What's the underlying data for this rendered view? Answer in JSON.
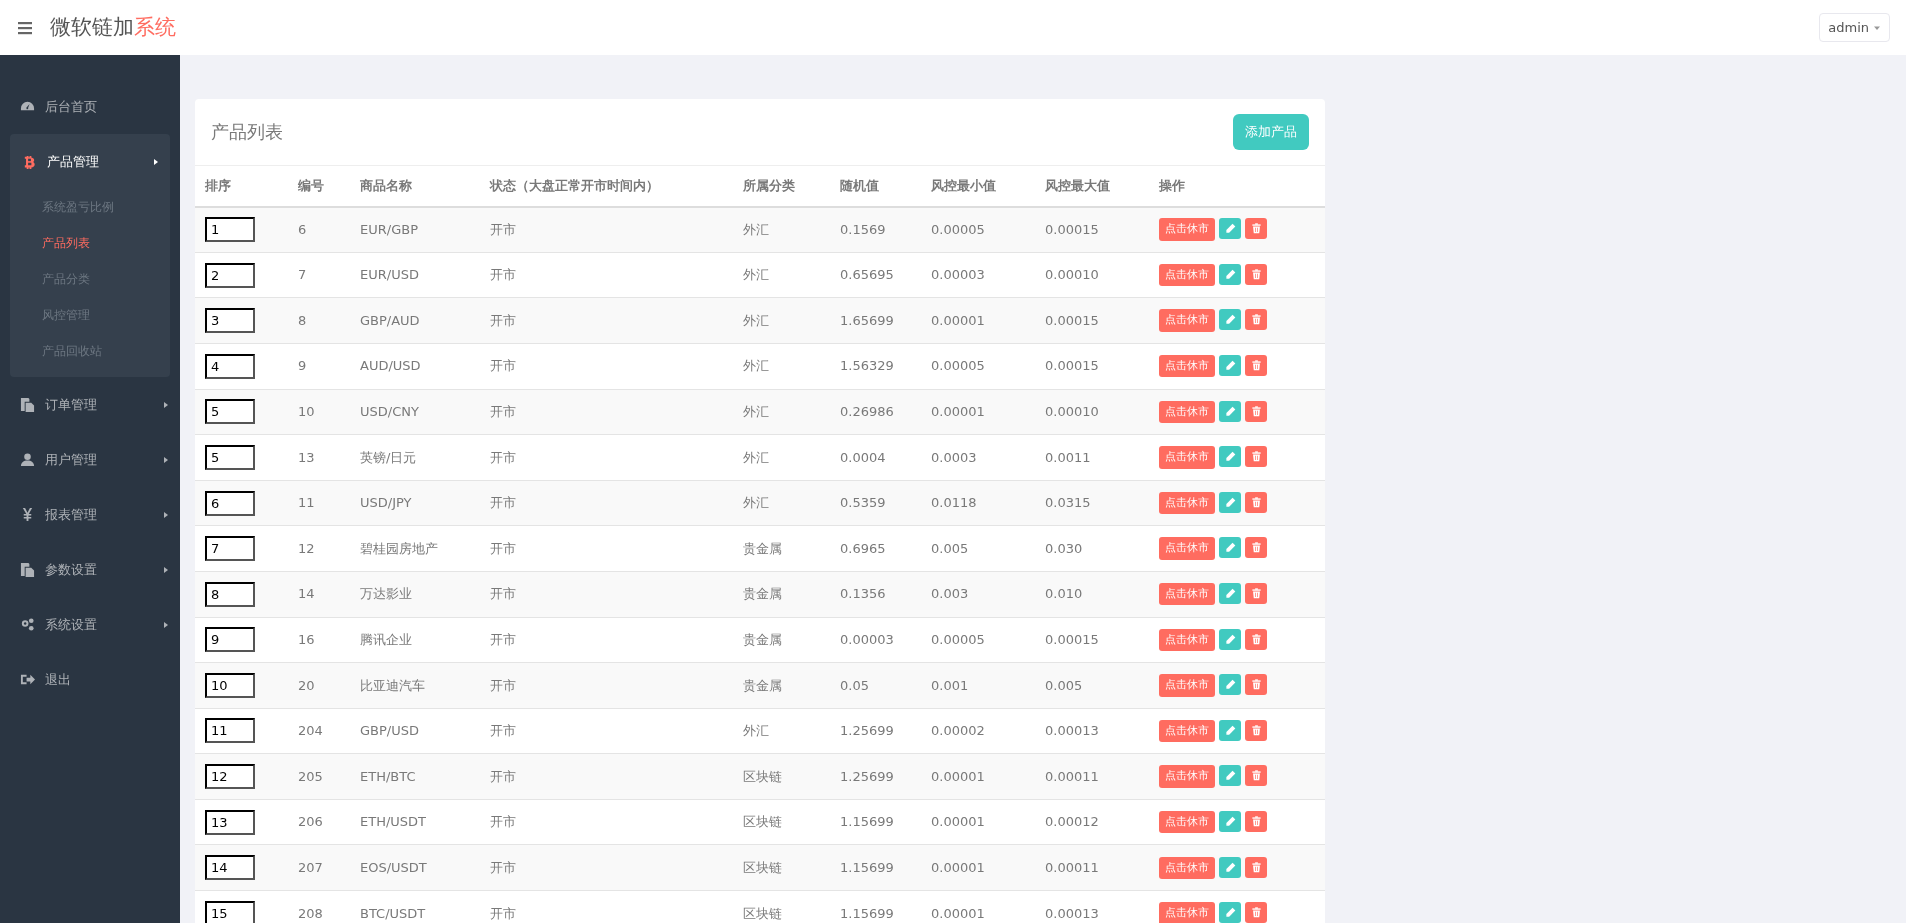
{
  "header": {
    "brand_main": "微软链加",
    "brand_accent": "系统",
    "user": "admin"
  },
  "sidebar": {
    "items": [
      {
        "label": "后台首页",
        "selected": false
      },
      {
        "label": "产品管理",
        "selected": true,
        "expanded": true,
        "children": [
          {
            "label": "系统盈亏比例",
            "selected": false
          },
          {
            "label": "产品列表",
            "selected": true
          },
          {
            "label": "产品分类",
            "selected": false
          },
          {
            "label": "风控管理",
            "selected": false
          },
          {
            "label": "产品回收站",
            "selected": false
          }
        ]
      },
      {
        "label": "订单管理",
        "selected": false,
        "expanded": false
      },
      {
        "label": "用户管理",
        "selected": false,
        "expanded": false
      },
      {
        "label": "报表管理",
        "selected": false,
        "expanded": false
      },
      {
        "label": "参数设置",
        "selected": false,
        "expanded": false
      },
      {
        "label": "系统设置",
        "selected": false,
        "expanded": false
      },
      {
        "label": "退出",
        "selected": false
      }
    ]
  },
  "panel": {
    "title": "产品列表",
    "add_button": "添加产品"
  },
  "table": {
    "columns": [
      "排序",
      "编号",
      "商品名称",
      "状态（大盘正常开市时间内）",
      "所属分类",
      "随机值",
      "风控最小值",
      "风控最大值",
      "操作"
    ],
    "rows": [
      {
        "sort": "1",
        "id": "6",
        "name": "EUR/GBP",
        "status": "开市",
        "category": "外汇",
        "random": "0.1569",
        "min": "0.00005",
        "max": "0.00015",
        "action": "点击休市"
      },
      {
        "sort": "2",
        "id": "7",
        "name": "EUR/USD",
        "status": "开市",
        "category": "外汇",
        "random": "0.65695",
        "min": "0.00003",
        "max": "0.00010",
        "action": "点击休市"
      },
      {
        "sort": "3",
        "id": "8",
        "name": "GBP/AUD",
        "status": "开市",
        "category": "外汇",
        "random": "1.65699",
        "min": "0.00001",
        "max": "0.00015",
        "action": "点击休市"
      },
      {
        "sort": "4",
        "id": "9",
        "name": "AUD/USD",
        "status": "开市",
        "category": "外汇",
        "random": "1.56329",
        "min": "0.00005",
        "max": "0.00015",
        "action": "点击休市"
      },
      {
        "sort": "5",
        "id": "10",
        "name": "USD/CNY",
        "status": "开市",
        "category": "外汇",
        "random": "0.26986",
        "min": "0.00001",
        "max": "0.00010",
        "action": "点击休市"
      },
      {
        "sort": "5",
        "id": "13",
        "name": "英镑/日元",
        "status": "开市",
        "category": "外汇",
        "random": "0.0004",
        "min": "0.0003",
        "max": "0.0011",
        "action": "点击休市"
      },
      {
        "sort": "6",
        "id": "11",
        "name": "USD/JPY",
        "status": "开市",
        "category": "外汇",
        "random": "0.5359",
        "min": "0.0118",
        "max": "0.0315",
        "action": "点击休市"
      },
      {
        "sort": "7",
        "id": "12",
        "name": "碧桂园房地产",
        "status": "开市",
        "category": "贵金属",
        "random": "0.6965",
        "min": "0.005",
        "max": "0.030",
        "action": "点击休市"
      },
      {
        "sort": "8",
        "id": "14",
        "name": "万达影业",
        "status": "开市",
        "category": "贵金属",
        "random": "0.1356",
        "min": "0.003",
        "max": "0.010",
        "action": "点击休市"
      },
      {
        "sort": "9",
        "id": "16",
        "name": "腾讯企业",
        "status": "开市",
        "category": "贵金属",
        "random": "0.00003",
        "min": "0.00005",
        "max": "0.00015",
        "action": "点击休市"
      },
      {
        "sort": "10",
        "id": "20",
        "name": "比亚迪汽车",
        "status": "开市",
        "category": "贵金属",
        "random": "0.05",
        "min": "0.001",
        "max": "0.005",
        "action": "点击休市"
      },
      {
        "sort": "11",
        "id": "204",
        "name": "GBP/USD",
        "status": "开市",
        "category": "外汇",
        "random": "1.25699",
        "min": "0.00002",
        "max": "0.00013",
        "action": "点击休市"
      },
      {
        "sort": "12",
        "id": "205",
        "name": "ETH/BTC",
        "status": "开市",
        "category": "区块链",
        "random": "1.25699",
        "min": "0.00001",
        "max": "0.00011",
        "action": "点击休市"
      },
      {
        "sort": "13",
        "id": "206",
        "name": "ETH/USDT",
        "status": "开市",
        "category": "区块链",
        "random": "1.15699",
        "min": "0.00001",
        "max": "0.00012",
        "action": "点击休市"
      },
      {
        "sort": "14",
        "id": "207",
        "name": "EOS/USDT",
        "status": "开市",
        "category": "区块链",
        "random": "1.15699",
        "min": "0.00001",
        "max": "0.00011",
        "action": "点击休市"
      },
      {
        "sort": "15",
        "id": "208",
        "name": "BTC/USDT",
        "status": "开市",
        "category": "区块链",
        "random": "1.15699",
        "min": "0.00001",
        "max": "0.00013",
        "action": "点击休市"
      }
    ]
  }
}
